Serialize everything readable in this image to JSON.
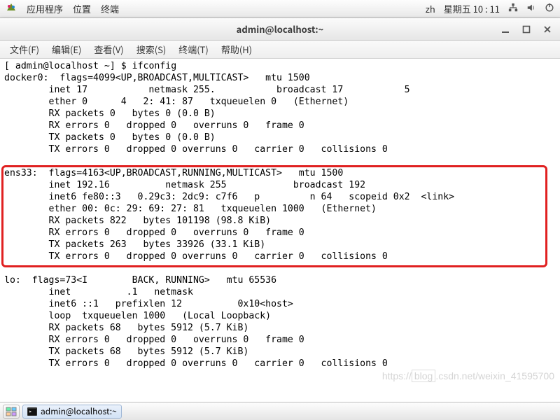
{
  "top_panel": {
    "apps": "应用程序",
    "places": "位置",
    "terminal": "终端",
    "keyboard": "zh",
    "datetime": "星期五 10 : 11"
  },
  "window": {
    "title": "admin@localhost:~",
    "menu": {
      "file": "文件(F)",
      "edit": "编辑(E)",
      "view": "查看(V)",
      "search": "搜索(S)",
      "terminal": "终端(T)",
      "help": "帮助(H)"
    }
  },
  "prompt": {
    "text": "[ admin@localhost ~] $ ",
    "cmd": "ifconfig"
  },
  "iface": {
    "docker0": {
      "l0": "docker0:  flags=4099<UP,BROADCAST,MULTICAST>   mtu 1500",
      "l1": "        inet 17           netmask 255.           broadcast 17           5",
      "l2": "        ether 0      4   2: 41: 87   txqueuelen 0   (Ethernet)",
      "l3": "        RX packets 0   bytes 0 (0.0 B)",
      "l4": "        RX errors 0   dropped 0   overruns 0   frame 0",
      "l5": "        TX packets 0   bytes 0 (0.0 B)",
      "l6": "        TX errors 0   dropped 0 overruns 0   carrier 0   collisions 0"
    },
    "ens33": {
      "l0": "ens33:  flags=4163<UP,BROADCAST,RUNNING,MULTICAST>   mtu 1500",
      "l1": "        inet 192.16          netmask 255            broadcast 192       ",
      "l2": "        inet6 fe80::3   0.29c3: 2dc9: c7f6   p         n 64   scopeid 0x2  <link>",
      "l3": "        ether 00: 0c: 29: 69: 27: 81   txqueuelen 1000   (Ethernet)",
      "l4": "        RX packets 822   bytes 101198 (98.8 KiB)",
      "l5": "        RX errors 0   dropped 0   overruns 0   frame 0",
      "l6": "        TX packets 263   bytes 33926 (33.1 KiB)",
      "l7": "        TX errors 0   dropped 0 overruns 0   carrier 0   collisions 0"
    },
    "lo": {
      "l0": "lo:  flags=73<I        BACK, RUNNING>   mtu 65536",
      "l1": "        inet          .1   netmask       ",
      "l2": "        inet6 ::1   prefixlen 12          0x10<host>",
      "l3": "        loop  txqueuelen 1000   (Local Loopback)",
      "l4": "        RX packets 68   bytes 5912 (5.7 KiB)",
      "l5": "        RX errors 0   dropped 0   overruns 0   frame 0",
      "l6": "        TX packets 68   bytes 5912 (5.7 KiB)",
      "l7": "        TX errors 0   dropped 0 overruns 0   carrier 0   collisions 0"
    }
  },
  "taskbar": {
    "item": "admin@localhost:~"
  },
  "watermark": {
    "a": "https://",
    "b": "blog",
    "c": ".csdn.net/weixin_41595700"
  }
}
